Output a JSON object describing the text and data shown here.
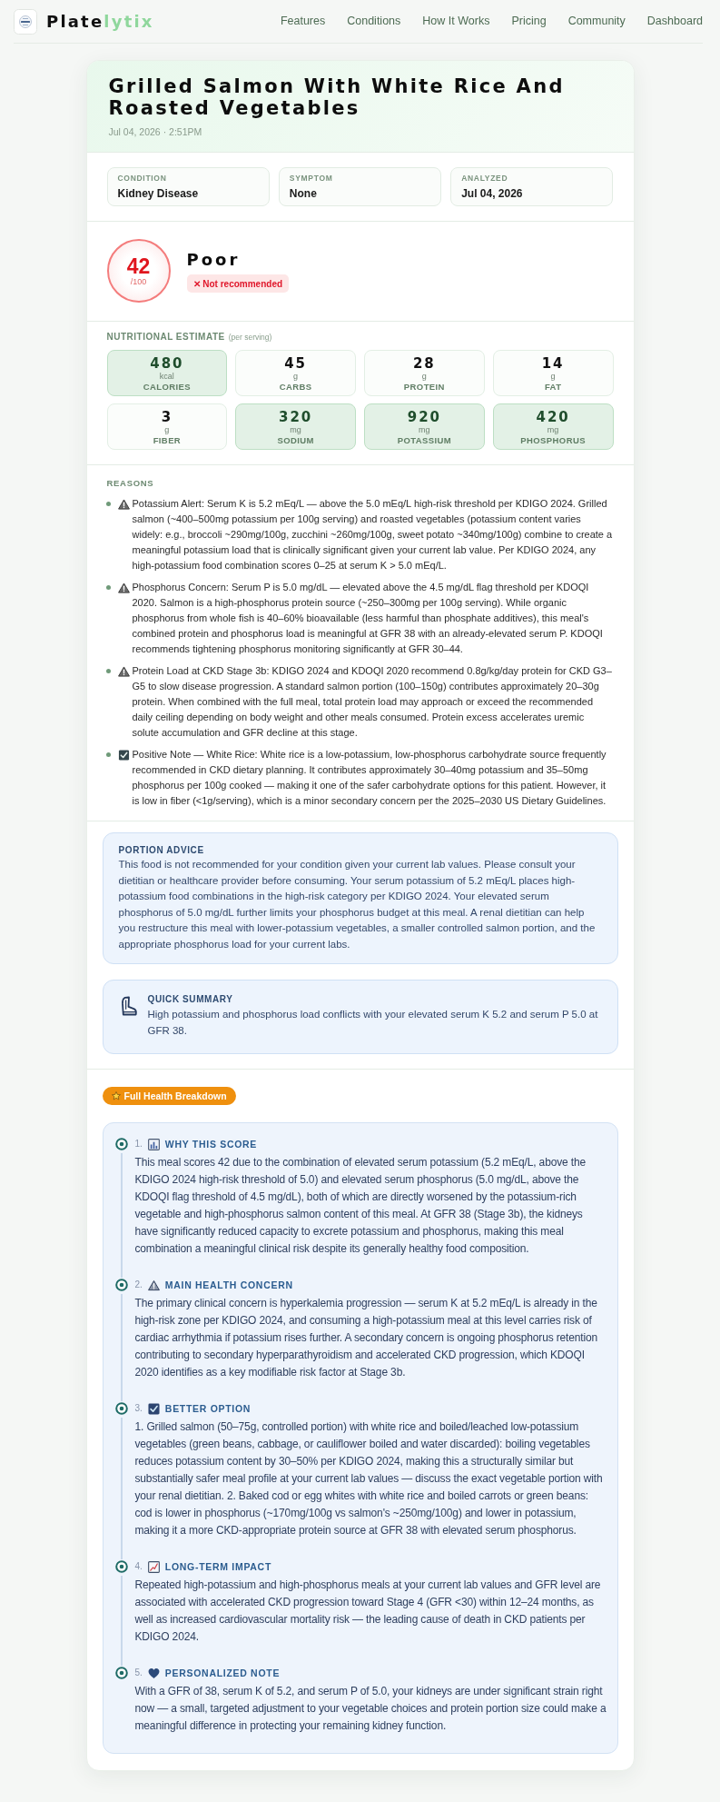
{
  "header": {
    "brand": {
      "name": "Plate",
      "accent": "lytix"
    },
    "nav": [
      "Features",
      "Conditions",
      "How It Works",
      "Pricing",
      "Community",
      "Dashboard"
    ]
  },
  "meal": {
    "title": "Grilled Salmon With White Rice And Roasted Vegetables",
    "timestamp": "Jul 04, 2026 · 2:51PM"
  },
  "details": [
    {
      "label": "CONDITION",
      "value": "Kidney Disease"
    },
    {
      "label": "SYMPTOM",
      "value": "None"
    },
    {
      "label": "ANALYZED",
      "value": "Jul 04, 2026"
    }
  ],
  "score": {
    "value": "42",
    "max": "/100",
    "rating": "Poor",
    "verdict": "✕ Not recommended",
    "recommended": false
  },
  "nutrition": {
    "title": "NUTRITIONAL ESTIMATE",
    "note": "(per serving)",
    "items": [
      {
        "amount": "480",
        "unit": "kcal",
        "name": "CALORIES",
        "highlighted": true
      },
      {
        "amount": "45",
        "unit": "g",
        "name": "CARBS",
        "highlighted": false
      },
      {
        "amount": "28",
        "unit": "g",
        "name": "PROTEIN",
        "highlighted": false
      },
      {
        "amount": "14",
        "unit": "g",
        "name": "FAT",
        "highlighted": false
      },
      {
        "amount": "3",
        "unit": "g",
        "name": "FIBER",
        "highlighted": false
      },
      {
        "amount": "320",
        "unit": "mg",
        "name": "SODIUM",
        "highlighted": true
      },
      {
        "amount": "920",
        "unit": "mg",
        "name": "POTASSIUM",
        "highlighted": true
      },
      {
        "amount": "420",
        "unit": "mg",
        "name": "PHOSPHORUS",
        "highlighted": true
      }
    ]
  },
  "reasons": {
    "title": "REASONS",
    "items": [
      {
        "kind": "warning",
        "text": "Potassium Alert: Serum K is 5.2 mEq/L — above the 5.0 mEq/L high-risk threshold per KDIGO 2024. Grilled salmon (~400–500mg potassium per 100g serving) and roasted vegetables (potassium content varies widely: e.g., broccoli ~290mg/100g, zucchini ~260mg/100g, sweet potato ~340mg/100g) combine to create a meaningful potassium load that is clinically significant given your current lab value. Per KDIGO 2024, any high-potassium food combination scores 0–25 at serum K > 5.0 mEq/L."
      },
      {
        "kind": "warning",
        "text": "Phosphorus Concern: Serum P is 5.0 mg/dL — elevated above the 4.5 mg/dL flag threshold per KDOQI 2020. Salmon is a high-phosphorus protein source (~250–300mg per 100g serving). While organic phosphorus from whole fish is 40–60% bioavailable (less harmful than phosphate additives), this meal's combined protein and phosphorus load is meaningful at GFR 38 with an already-elevated serum P. KDOQI recommends tightening phosphorus monitoring significantly at GFR 30–44."
      },
      {
        "kind": "warning",
        "text": "Protein Load at CKD Stage 3b: KDIGO 2024 and KDOQI 2020 recommend 0.8g/kg/day protein for CKD G3–G5 to slow disease progression. A standard salmon portion (100–150g) contributes approximately 20–30g protein. When combined with the full meal, total protein load may approach or exceed the recommended daily ceiling depending on body weight and other meals consumed. Protein excess accelerates uremic solute accumulation and GFR decline at this stage."
      },
      {
        "kind": "positive",
        "text": "Positive Note — White Rice: White rice is a low-potassium, low-phosphorus carbohydrate source frequently recommended in CKD dietary planning. It contributes approximately 30–40mg potassium and 35–50mg phosphorus per 100g cooked — making it one of the safer carbohydrate options for this patient. However, it is low in fiber (<1g/serving), which is a minor secondary concern per the 2025–2030 US Dietary Guidelines."
      }
    ]
  },
  "portion_advice": {
    "title": "PORTION ADVICE",
    "text": "This food is not recommended for your condition given your current lab values. Please consult your dietitian or healthcare provider before consuming. Your serum potassium of 5.2 mEq/L places high-potassium food combinations in the high-risk category per KDIGO 2024. Your elevated serum phosphorus of 5.0 mg/dL further limits your phosphorus budget at this meal. A renal dietitian can help you restructure this meal with lower-potassium vegetables, a smaller controlled salmon portion, and the appropriate phosphorus load for your current labs."
  },
  "quick_summary": {
    "title": "QUICK SUMMARY",
    "text": "High potassium and phosphorus load conflicts with your elevated serum K 5.2 and serum P 5.0 at GFR 38."
  },
  "breakdown": {
    "badge": "Full Health Breakdown",
    "items": [
      {
        "number": "1.",
        "kind": "chart",
        "title": "WHY THIS SCORE",
        "text": "This meal scores 42 due to the combination of elevated serum potassium (5.2 mEq/L, above the KDIGO 2024 high-risk threshold of 5.0) and elevated serum phosphorus (5.0 mg/dL, above the KDOQI flag threshold of 4.5 mg/dL), both of which are directly worsened by the potassium-rich vegetable and high-phosphorus salmon content of this meal. At GFR 38 (Stage 3b), the kidneys have significantly reduced capacity to excrete potassium and phosphorus, making this meal combination a meaningful clinical risk despite its generally healthy food composition."
      },
      {
        "number": "2.",
        "kind": "warning",
        "title": "MAIN HEALTH CONCERN",
        "text": "The primary clinical concern is hyperkalemia progression — serum K at 5.2 mEq/L is already in the high-risk zone per KDIGO 2024, and consuming a high-potassium meal at this level carries risk of cardiac arrhythmia if potassium rises further. A secondary concern is ongoing phosphorus retention contributing to secondary hyperparathyroidism and accelerated CKD progression, which KDOQI 2020 identifies as a key modifiable risk factor at Stage 3b."
      },
      {
        "number": "3.",
        "kind": "check",
        "title": "BETTER OPTION",
        "text": "1. Grilled salmon (50–75g, controlled portion) with white rice and boiled/leached low-potassium vegetables (green beans, cabbage, or cauliflower boiled and water discarded): boiling vegetables reduces potassium content by 30–50% per KDIGO 2024, making this a structurally similar but substantially safer meal profile at your current lab values — discuss the exact vegetable portion with your renal dietitian. 2. Baked cod or egg whites with white rice and boiled carrots or green beans: cod is lower in phosphorus (~170mg/100g vs salmon's ~250mg/100g) and lower in potassium, making it a more CKD-appropriate protein source at GFR 38 with elevated serum phosphorus."
      },
      {
        "number": "4.",
        "kind": "trend",
        "title": "LONG-TERM IMPACT",
        "text": "Repeated high-potassium and high-phosphorus meals at your current lab values and GFR level are associated with accelerated CKD progression toward Stage 4 (GFR <30) within 12–24 months, as well as increased cardiovascular mortality risk — the leading cause of death in CKD patients per KDIGO 2024."
      },
      {
        "number": "5.",
        "kind": "heart",
        "title": "PERSONALIZED NOTE",
        "text": "With a GFR of 38, serum K of 5.2, and serum P of 5.0, your kidneys are under significant strain right now — a small, targeted adjustment to your vegetable choices and protein portion size could make a meaningful difference in protecting your remaining kidney function."
      }
    ]
  }
}
